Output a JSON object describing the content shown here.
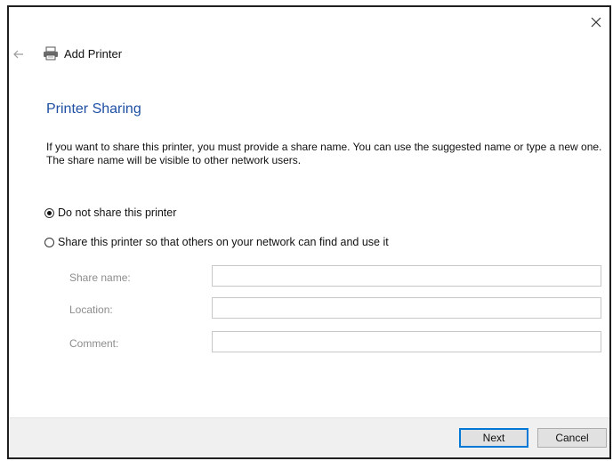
{
  "window": {
    "title": "Add Printer"
  },
  "icons": {
    "close": "close-icon",
    "back": "back-arrow-icon",
    "printer": "printer-icon"
  },
  "page": {
    "heading": "Printer Sharing",
    "description": "If you want to share this printer, you must provide a share name. You can use the suggested name or type a new one. The share name will be visible to other network users."
  },
  "options": [
    {
      "label": "Do not share this printer",
      "selected": true
    },
    {
      "label": "Share this printer so that others on your network can find and use it",
      "selected": false
    }
  ],
  "fields": {
    "share_name_label": "Share name:",
    "share_name_value": "",
    "location_label": "Location:",
    "location_value": "",
    "comment_label": "Comment:",
    "comment_value": ""
  },
  "buttons": {
    "next": "Next",
    "cancel": "Cancel"
  },
  "colors": {
    "heading": "#1e4fa3",
    "primary_border": "#0078d7",
    "footer_bg": "#f0f0f0"
  }
}
